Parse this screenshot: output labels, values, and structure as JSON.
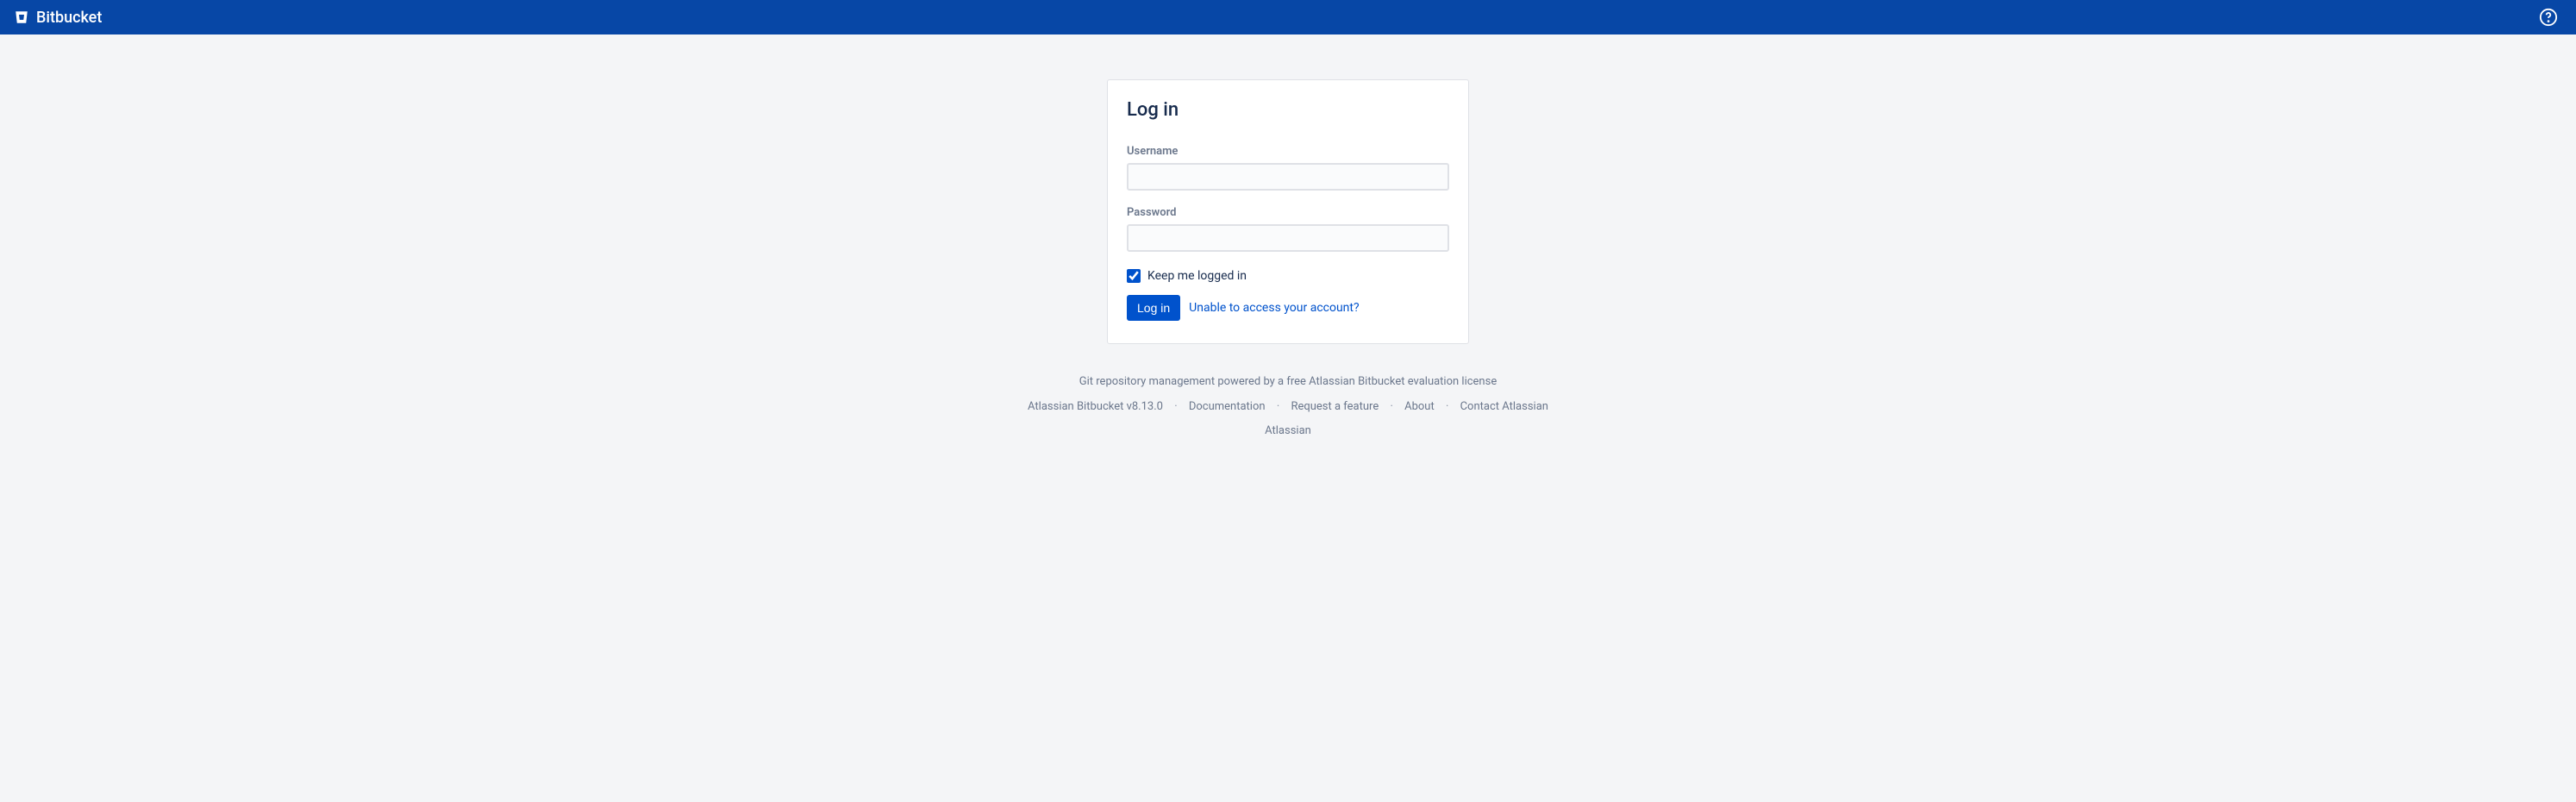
{
  "header": {
    "product_name": "Bitbucket"
  },
  "login": {
    "title": "Log in",
    "username_label": "Username",
    "username_value": "",
    "password_label": "Password",
    "password_value": "",
    "remember_label": "Keep me logged in",
    "remember_checked": true,
    "submit_label": "Log in",
    "help_link_label": "Unable to access your account?"
  },
  "footer": {
    "tagline": "Git repository management powered by a free Atlassian Bitbucket evaluation license",
    "version": "Atlassian Bitbucket v8.13.0",
    "links": {
      "documentation": "Documentation",
      "request_feature": "Request a feature",
      "about": "About",
      "contact": "Contact Atlassian"
    },
    "company": "Atlassian"
  }
}
